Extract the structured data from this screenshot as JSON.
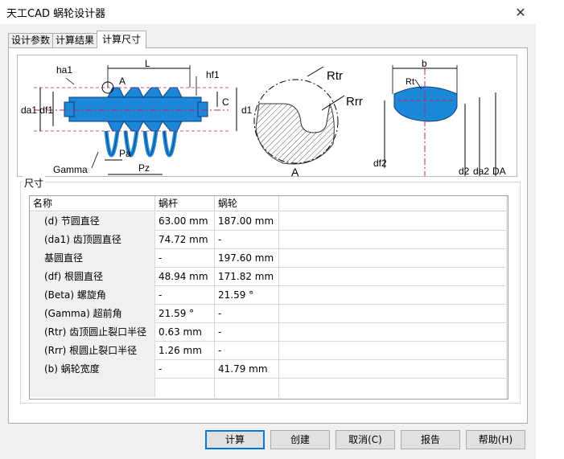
{
  "window": {
    "title": "天工CAD 蜗轮设计器",
    "close_glyph": "✕"
  },
  "tabs": [
    {
      "label": "设计参数"
    },
    {
      "label": "计算结果"
    },
    {
      "label": "计算尺寸"
    }
  ],
  "figure": {
    "labels": {
      "ha1": "ha1",
      "L": "L",
      "hf1": "hf1",
      "A": "A",
      "C": "C",
      "d1": "d1",
      "da1_df1": "da1 df1",
      "Pa": "Pa",
      "Pz": "Pz",
      "Gamma": "Gamma",
      "Rtr": "Rtr",
      "Rrr": "Rrr",
      "A2": "A",
      "b": "b",
      "Rt": "Rt",
      "df2": "df2",
      "d2": "d2",
      "da2": "da2",
      "DA": "DA"
    }
  },
  "dimensions": {
    "group_label": "尺寸",
    "columns": [
      "名称",
      "蜗杆",
      "蜗轮"
    ],
    "rows": [
      {
        "name": "(d) 节圆直径",
        "worm": "63.00 mm",
        "gear": "187.00 mm"
      },
      {
        "name": "(da1) 齿顶圆直径",
        "worm": "74.72 mm",
        "gear": "-"
      },
      {
        "name": "基圆直径",
        "worm": "-",
        "gear": "197.60 mm"
      },
      {
        "name": "(df) 根圆直径",
        "worm": "48.94 mm",
        "gear": "171.82 mm"
      },
      {
        "name": "(Beta) 螺旋角",
        "worm": "-",
        "gear": "21.59 °"
      },
      {
        "name": "(Gamma) 超前角",
        "worm": "21.59 °",
        "gear": "-"
      },
      {
        "name": "(Rtr) 齿顶圆止裂口半径",
        "worm": "0.63 mm",
        "gear": "-"
      },
      {
        "name": "(Rrr) 根圆止裂口半径",
        "worm": "1.26 mm",
        "gear": "-"
      },
      {
        "name": "(b) 蜗轮宽度",
        "worm": "-",
        "gear": "41.79 mm"
      }
    ],
    "scroll_up": "▲",
    "scroll_down": "▼"
  },
  "buttons": {
    "calculate": "计算",
    "create": "创建",
    "cancel": "取消(C)",
    "report": "报告",
    "help": "帮助(H)"
  }
}
